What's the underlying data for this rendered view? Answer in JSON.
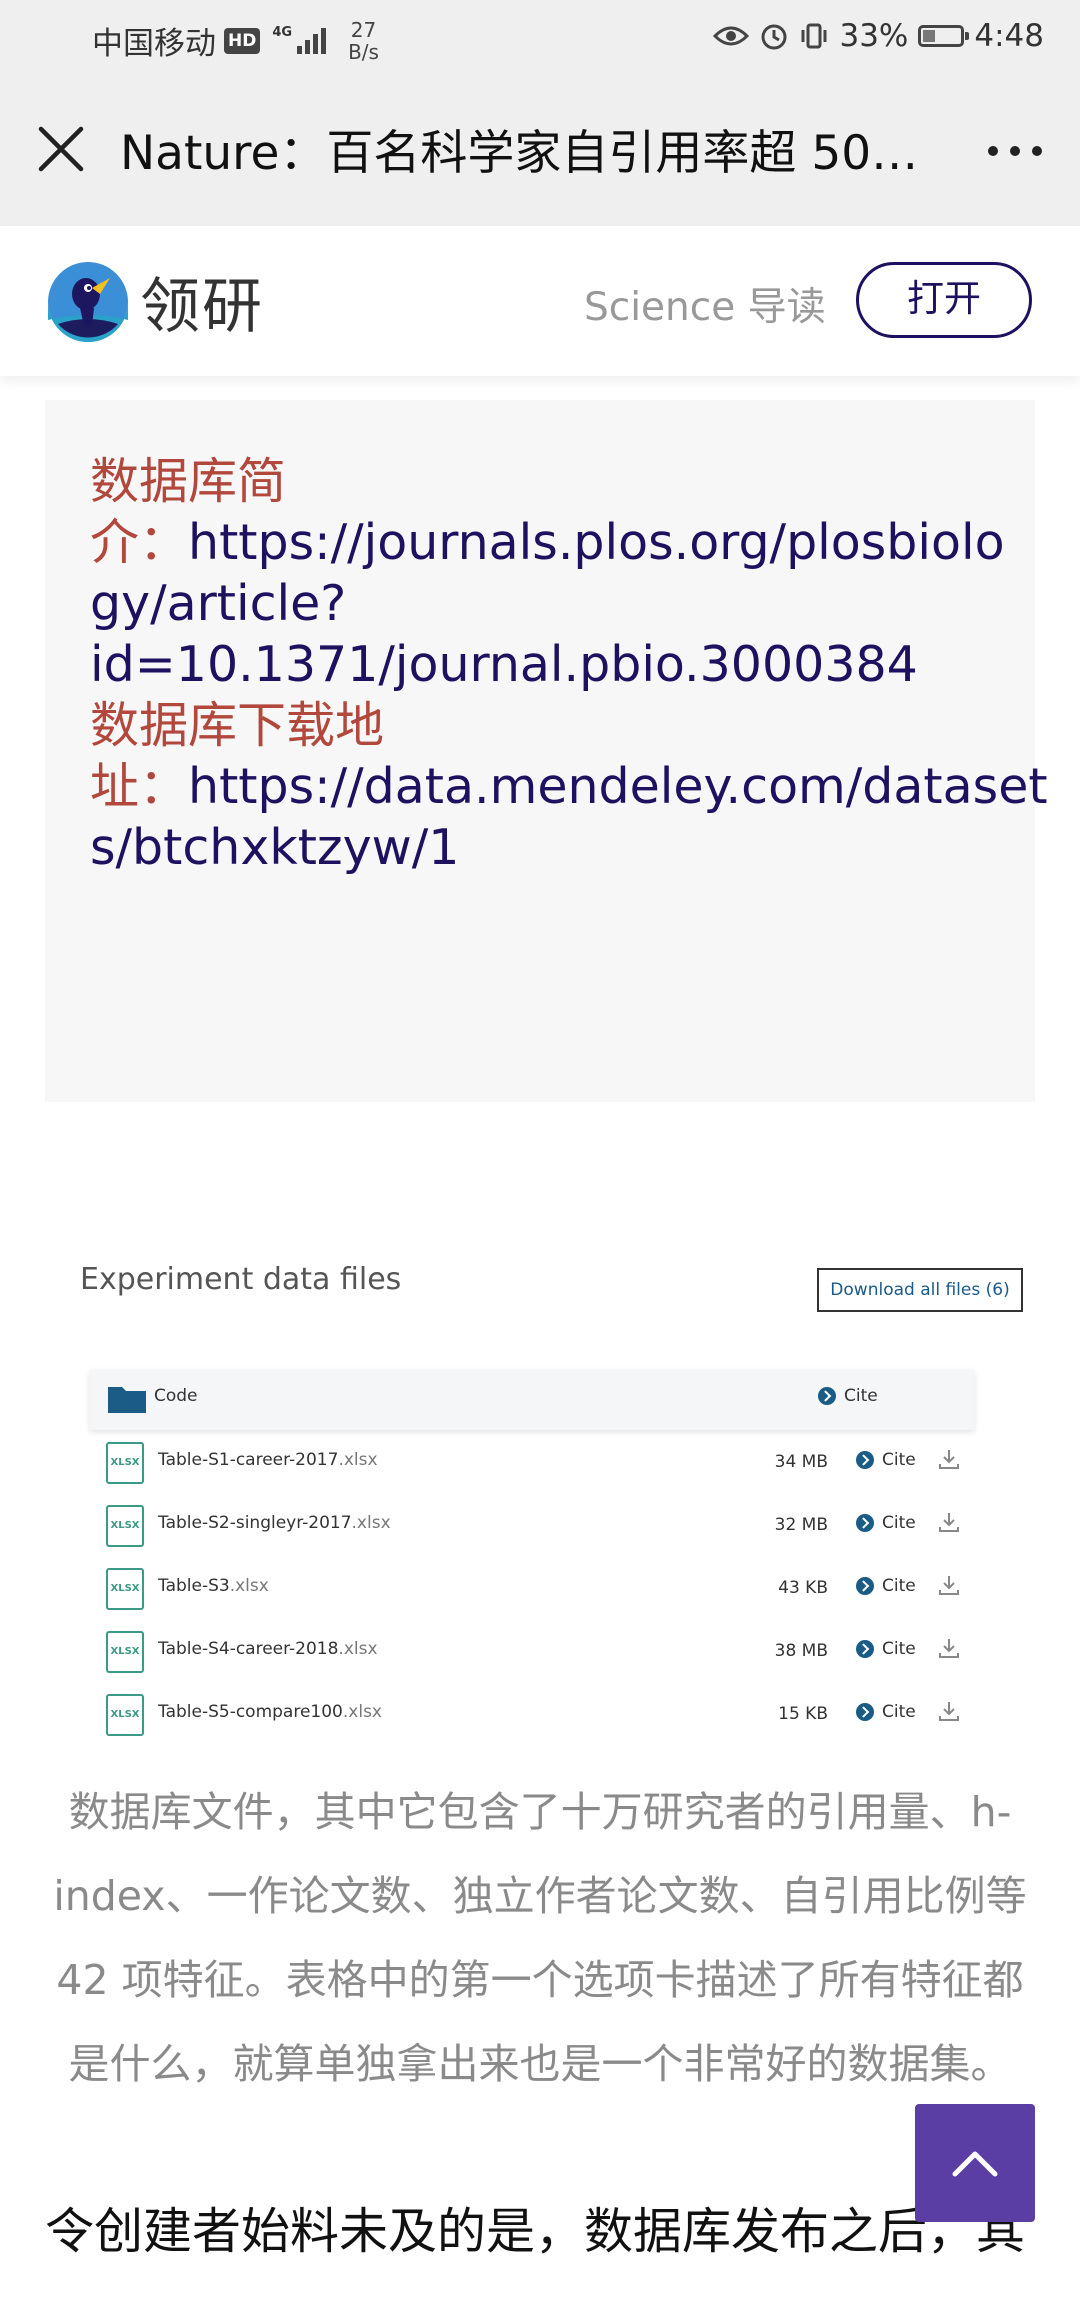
{
  "status_bar": {
    "carrier": "中国移动",
    "hd": "HD",
    "network": "4G",
    "speed_value": "27",
    "speed_unit": "B/s",
    "battery_percent": "33%",
    "battery_level": 0.33,
    "time": "4:48"
  },
  "title_bar": {
    "title": "Nature：百名科学家自引用率超 50%…"
  },
  "app_banner": {
    "app_name": "领研",
    "subtitle": "Science 导读",
    "open_label": "打开"
  },
  "quote": {
    "intro_label_1": "数据库简",
    "intro_label_2": "介：",
    "intro_link_1": "https://journals.plos.org/plosbiolo",
    "intro_link_2": "gy/article?",
    "intro_link_3": "id=10.1371/journal.pbio.3000384",
    "download_label_1": "数据库下载地",
    "download_label_2": "址：",
    "download_link_1": "https://data.mendeley.com/dataset",
    "download_link_2": "s/btchxktzyw/1"
  },
  "embedded": {
    "title": "Experiment data files",
    "download_all": "Download all files (6)",
    "folder_label": "Code",
    "cite_label": "Cite",
    "files": [
      {
        "name": "Table-S1-career-2017",
        "ext": ".xlsx",
        "size": "34 MB",
        "icon": "XLSX"
      },
      {
        "name": "Table-S2-singleyr-2017",
        "ext": ".xlsx",
        "size": "32 MB",
        "icon": "XLSX"
      },
      {
        "name": "Table-S3",
        "ext": ".xlsx",
        "size": "43 KB",
        "icon": "XLSX"
      },
      {
        "name": "Table-S4-career-2018",
        "ext": ".xlsx",
        "size": "38 MB",
        "icon": "XLSX"
      },
      {
        "name": "Table-S5-compare100",
        "ext": ".xlsx",
        "size": "15 KB",
        "icon": "XLSX"
      }
    ]
  },
  "paragraph": {
    "line1": "数据库文件，其中它包含了十万研究者的引用量、h-",
    "line2": "index、一作论文数、独立作者论文数、自引用比例等",
    "line3": "42 项特征。表格中的第一个选项卡描述了所有特征都",
    "line4": "是什么，就算单独拿出来也是一个非常好的数据集。"
  },
  "next_paragraph": "令创建者始料未及的是，数据库发布之后，其",
  "colors": {
    "accent_purple": "#5a3ea4",
    "link_navy": "#1e1160",
    "label_red": "#b2473c"
  }
}
